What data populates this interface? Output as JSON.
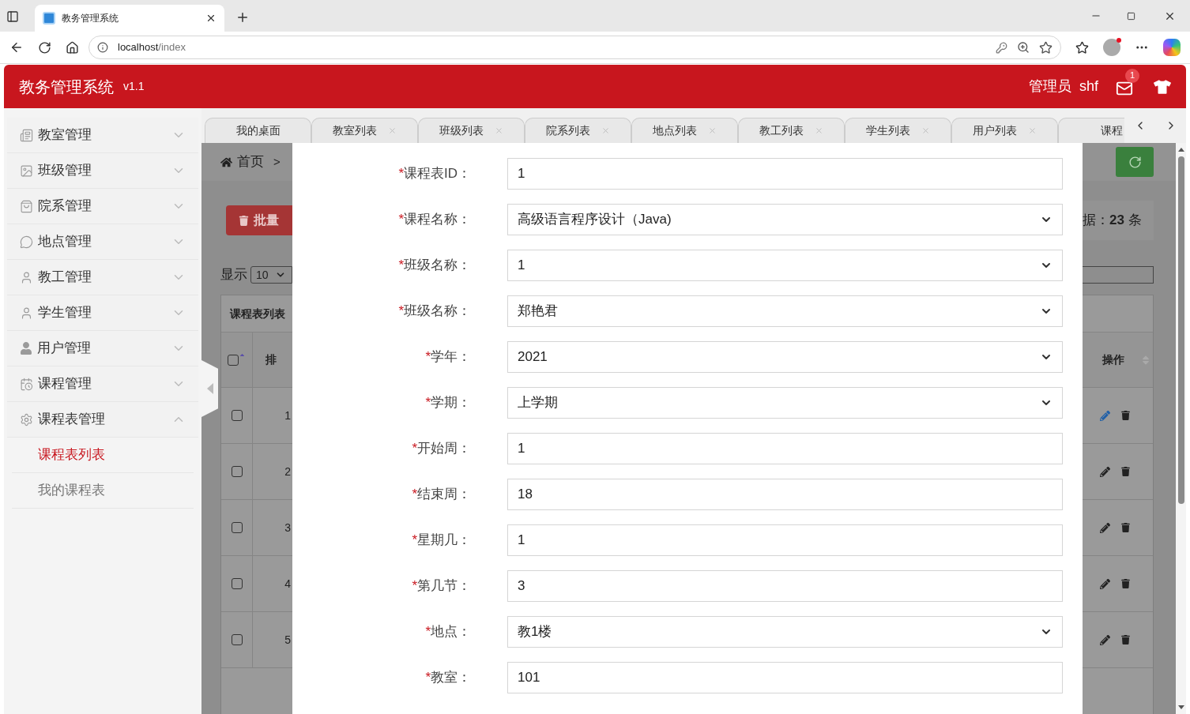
{
  "browser": {
    "tab_title": "教务管理系统",
    "url_host": "localhost",
    "url_path": "/index"
  },
  "header": {
    "title": "教务管理系统",
    "version": "v1.1",
    "role": "管理员",
    "username": "shf",
    "mail_count": "1"
  },
  "sidebar": {
    "items": [
      {
        "label": "教室管理",
        "expanded": false
      },
      {
        "label": "班级管理",
        "expanded": false
      },
      {
        "label": "院系管理",
        "expanded": false
      },
      {
        "label": "地点管理",
        "expanded": false
      },
      {
        "label": "教工管理",
        "expanded": false
      },
      {
        "label": "学生管理",
        "expanded": false
      },
      {
        "label": "用户管理",
        "expanded": false
      },
      {
        "label": "课程管理",
        "expanded": false
      },
      {
        "label": "课程表管理",
        "expanded": true,
        "children": [
          {
            "label": "课程表列表",
            "selected": true
          },
          {
            "label": "我的课程表",
            "selected": false
          }
        ]
      }
    ]
  },
  "tabs": [
    {
      "label": "我的桌面",
      "closable": false
    },
    {
      "label": "教室列表",
      "closable": true
    },
    {
      "label": "班级列表",
      "closable": true
    },
    {
      "label": "院系列表",
      "closable": true
    },
    {
      "label": "地点列表",
      "closable": true
    },
    {
      "label": "教工列表",
      "closable": true
    },
    {
      "label": "学生列表",
      "closable": true
    },
    {
      "label": "用户列表",
      "closable": true
    },
    {
      "label": "课程",
      "closable": false
    }
  ],
  "page": {
    "select_all_checked": false,
    "breadcrumb": "首页",
    "breadcrumb_separator": ">",
    "batch_button": "批量",
    "show_label": "显示",
    "page_size": "10",
    "table_title": "课程表列表",
    "column_2": "排",
    "total": "据：**23** 条",
    "action_column": "操作",
    "rows": [
      {
        "cell": "1",
        "hover": true,
        "checked": false
      },
      {
        "cell": "2",
        "hover": false,
        "checked": false
      },
      {
        "cell": "3",
        "hover": false,
        "checked": false
      },
      {
        "cell": "4",
        "hover": false,
        "checked": false
      },
      {
        "cell": "5",
        "hover": false,
        "checked": false
      }
    ]
  },
  "form": {
    "fields": [
      {
        "mark": "*",
        "label": "课程表ID：",
        "kind": "text",
        "value": "1"
      },
      {
        "mark": "*",
        "label": "课程名称：",
        "kind": "select",
        "value": "高级语言程序设计（Java)"
      },
      {
        "mark": "*",
        "label": "班级名称：",
        "kind": "select",
        "value": "1"
      },
      {
        "mark": "*",
        "label": "班级名称：",
        "kind": "select",
        "value": "郑艳君"
      },
      {
        "mark": "*",
        "label": "学年：",
        "kind": "select",
        "value": "2021"
      },
      {
        "mark": "*",
        "label": "学期：",
        "kind": "select",
        "value": "上学期"
      },
      {
        "mark": "*",
        "label": "开始周：",
        "kind": "text",
        "value": "1"
      },
      {
        "mark": "*",
        "label": "结束周：",
        "kind": "text",
        "value": "18"
      },
      {
        "mark": "*",
        "label": "星期几：",
        "kind": "text",
        "value": "1"
      },
      {
        "mark": "*",
        "label": "第几节：",
        "kind": "text",
        "value": "3"
      },
      {
        "mark": "*",
        "label": "地点：",
        "kind": "select",
        "value": "教1楼"
      },
      {
        "mark": "*",
        "label": "教室：",
        "kind": "text",
        "value": "101"
      }
    ]
  }
}
